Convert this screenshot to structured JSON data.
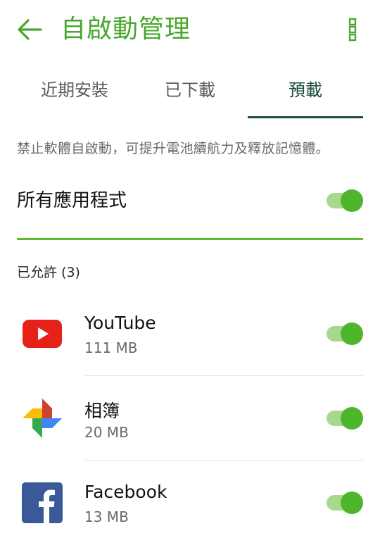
{
  "header": {
    "title": "自啟動管理",
    "back_icon": "back-arrow-icon",
    "more_icon": "more-vert-icon",
    "accent_color": "#48a82c"
  },
  "tabs": [
    {
      "label": "近期安裝",
      "active": false
    },
    {
      "label": "已下載",
      "active": false
    },
    {
      "label": "預載",
      "active": true
    }
  ],
  "description": "禁止軟體自啟動，可提升電池續航力及釋放記憶體。",
  "all_apps": {
    "label": "所有應用程式",
    "enabled": true
  },
  "section": {
    "header": "已允許 (3)"
  },
  "apps": [
    {
      "name": "YouTube",
      "size": "111 MB",
      "icon": "youtube-icon",
      "enabled": true
    },
    {
      "name": "相簿",
      "size": "20 MB",
      "icon": "photos-pinwheel-icon",
      "enabled": true
    },
    {
      "name": "Facebook",
      "size": "13 MB",
      "icon": "facebook-icon",
      "enabled": true
    }
  ]
}
